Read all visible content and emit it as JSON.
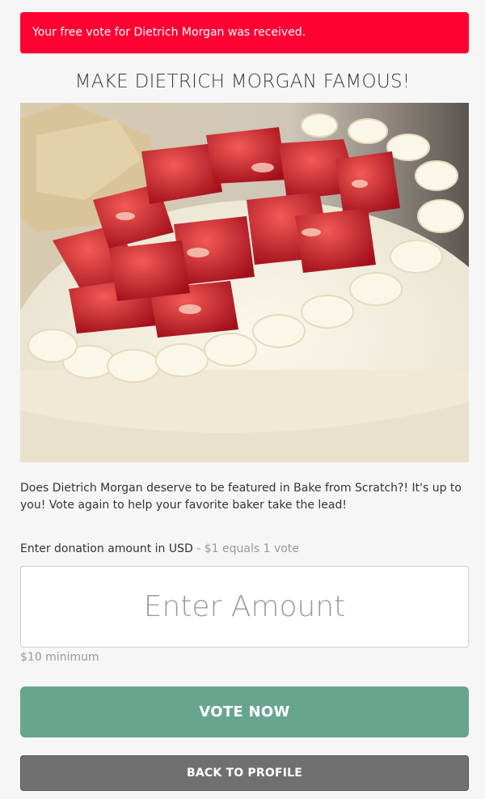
{
  "alert": {
    "message": "Your free vote for Dietrich Morgan was received.",
    "color": "#ff0033"
  },
  "page": {
    "title": "MAKE DIETRICH MORGAN FAMOUS!",
    "description": "Does Dietrich Morgan deserve to be featured in Bake from Scratch?! It's up to you! Vote again to help your favorite baker take the lead!"
  },
  "donation": {
    "label": "Enter donation amount in USD",
    "hint": " - $1 equals 1 vote",
    "placeholder": "Enter Amount",
    "value": "",
    "minimum": "$10 minimum"
  },
  "buttons": {
    "vote": "VOTE NOW",
    "back": "BACK TO PROFILE",
    "vote_color": "#68a58f",
    "back_color": "#707070"
  }
}
